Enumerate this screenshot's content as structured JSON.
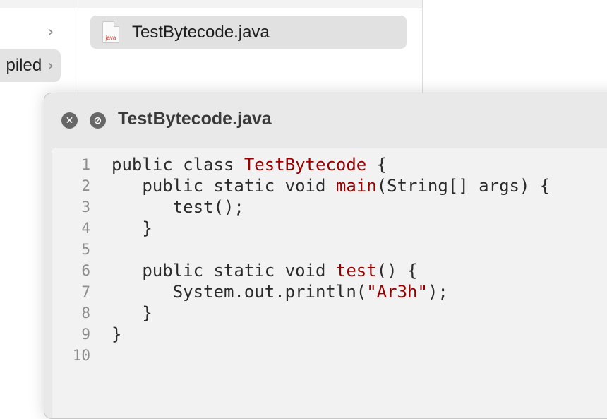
{
  "finder": {
    "column1_items": [
      {
        "label": ""
      },
      {
        "label": "piled"
      }
    ],
    "selected_file": {
      "name": "TestBytecode.java",
      "icon_tag": "java"
    }
  },
  "quicklook": {
    "title": "TestBytecode.java",
    "buttons": {
      "close_icon": "x-circle-icon",
      "noentry_icon": "slash-circle-icon"
    },
    "lines": [
      {
        "n": "1",
        "segments": [
          {
            "t": "public class ",
            "c": ""
          },
          {
            "t": "TestBytecode",
            "c": "hl"
          },
          {
            "t": " {",
            "c": ""
          }
        ]
      },
      {
        "n": "2",
        "segments": [
          {
            "t": "   public static void ",
            "c": ""
          },
          {
            "t": "main",
            "c": "hl"
          },
          {
            "t": "(String[] args) {",
            "c": ""
          }
        ]
      },
      {
        "n": "3",
        "segments": [
          {
            "t": "      test();",
            "c": ""
          }
        ]
      },
      {
        "n": "4",
        "segments": [
          {
            "t": "   }",
            "c": ""
          }
        ]
      },
      {
        "n": "5",
        "segments": [
          {
            "t": "",
            "c": ""
          }
        ]
      },
      {
        "n": "6",
        "segments": [
          {
            "t": "   public static void ",
            "c": ""
          },
          {
            "t": "test",
            "c": "hl"
          },
          {
            "t": "() {",
            "c": ""
          }
        ]
      },
      {
        "n": "7",
        "segments": [
          {
            "t": "      System.out.println(",
            "c": ""
          },
          {
            "t": "\"Ar3h\"",
            "c": "str"
          },
          {
            "t": ");",
            "c": ""
          }
        ]
      },
      {
        "n": "8",
        "segments": [
          {
            "t": "   }",
            "c": ""
          }
        ]
      },
      {
        "n": "9",
        "segments": [
          {
            "t": "}",
            "c": ""
          }
        ]
      },
      {
        "n": "10",
        "segments": [
          {
            "t": "",
            "c": ""
          }
        ]
      }
    ]
  },
  "colors": {
    "keyword_highlight": "#9a0000",
    "selection_bg": "#e1e1e1",
    "titlebar_button": "#676767"
  }
}
